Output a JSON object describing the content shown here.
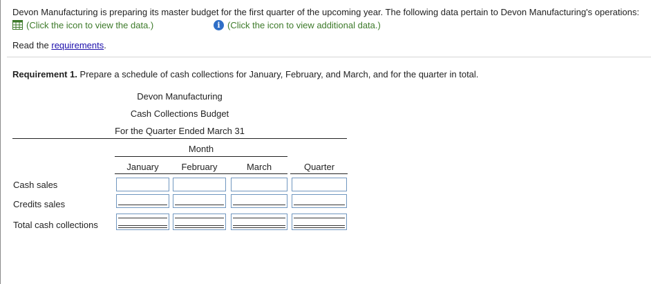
{
  "intro": {
    "text": "Devon Manufacturing is preparing its master budget for the first quarter of the upcoming year. The following data pertain to Devon Manufacturing's operations:",
    "data_link": "(Click the icon to view the data.)",
    "data_icon": "table-grid-icon",
    "additional_link": "(Click the icon to view additional data.)",
    "additional_icon": "info-icon",
    "read_prefix": "Read the ",
    "requirements_link": "requirements",
    "read_suffix": "."
  },
  "requirement": {
    "label": "Requirement 1.",
    "text": " Prepare a schedule of cash collections for January, February, and March, and for the quarter in total."
  },
  "schedule": {
    "company": "Devon Manufacturing",
    "title": "Cash Collections Budget",
    "period": "For the Quarter Ended March 31",
    "month_header": "Month",
    "columns": [
      "January",
      "February",
      "March",
      "Quarter"
    ],
    "rows": [
      {
        "label": "Cash sales",
        "values": [
          "",
          "",
          "",
          ""
        ]
      },
      {
        "label": "Credits sales",
        "values": [
          "",
          "",
          "",
          ""
        ]
      },
      {
        "label": "Total cash collections",
        "values": [
          "",
          "",
          "",
          ""
        ]
      }
    ]
  },
  "colors": {
    "link_green": "#3d7a2a",
    "link_blue": "#1a0dab",
    "input_border": "#6f96bf",
    "info_icon_bg": "#2e6ec7"
  }
}
